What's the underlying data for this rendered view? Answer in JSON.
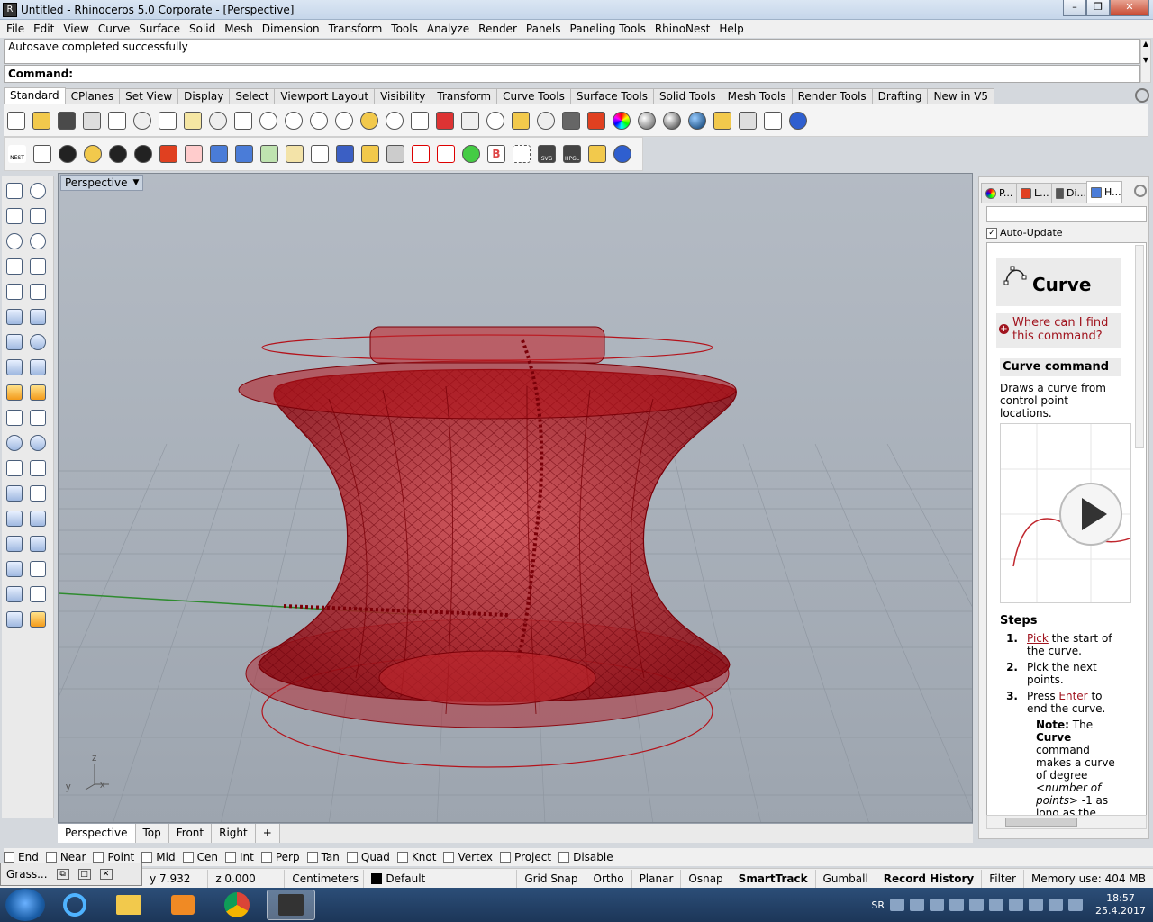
{
  "window": {
    "title": "Untitled - Rhinoceros  5.0 Corporate - [Perspective]",
    "min_label": "–",
    "max_label": "❐",
    "close_label": "✕"
  },
  "menu": [
    "File",
    "Edit",
    "View",
    "Curve",
    "Surface",
    "Solid",
    "Mesh",
    "Dimension",
    "Transform",
    "Tools",
    "Analyze",
    "Render",
    "Panels",
    "Paneling Tools",
    "RhinoNest",
    "Help"
  ],
  "command": {
    "history": "Autosave completed successfully",
    "prompt": "Command:"
  },
  "toolbar_tabs": [
    "Standard",
    "CPlanes",
    "Set View",
    "Display",
    "Select",
    "Viewport Layout",
    "Visibility",
    "Transform",
    "Curve Tools",
    "Surface Tools",
    "Solid Tools",
    "Mesh Tools",
    "Render Tools",
    "Drafting",
    "New in V5"
  ],
  "toolbar2_labels": {
    "nest": "NEST",
    "svg": "SVG",
    "hpgl": "HPGL",
    "bold_b": "B"
  },
  "viewport": {
    "label": "Perspective",
    "axis_z": "z",
    "axis_y": "y",
    "axis_x": "x"
  },
  "view_tabs": [
    "Perspective",
    "Top",
    "Front",
    "Right",
    "+"
  ],
  "right_panel": {
    "tabs": [
      "P...",
      "L...",
      "Di...",
      "H..."
    ],
    "auto_update": "Auto-Update",
    "help_title": "Curve",
    "where_link": "Where can I find this command?",
    "command_heading": "Curve command",
    "description": "Draws a curve from control point locations.",
    "steps_heading": "Steps",
    "steps": [
      {
        "n": "1.",
        "link": "Pick",
        "rest": " the start of the curve."
      },
      {
        "n": "2.",
        "link": "",
        "rest": "Pick the next points."
      },
      {
        "n": "3.",
        "link": "Enter",
        "pre": "Press ",
        "rest": " to end the curve."
      }
    ],
    "note_label": "Note:",
    "note_text1": " The ",
    "note_bold": "Curve",
    "note_text2": " command makes a curve of degree ",
    "note_italic": "<number of points>",
    "note_text3": " -1 as long as the"
  },
  "osnaps": [
    "End",
    "Near",
    "Point",
    "Mid",
    "Cen",
    "Int",
    "Perp",
    "Tan",
    "Quad",
    "Knot",
    "Vertex",
    "Project",
    "Disable"
  ],
  "status": {
    "grasshopper": "Grass...",
    "y": "y 7.932",
    "z": "z 0.000",
    "units": "Centimeters",
    "layer": "Default",
    "grid_snap": "Grid Snap",
    "ortho": "Ortho",
    "planar": "Planar",
    "osnap": "Osnap",
    "smarttrack": "SmartTrack",
    "gumball": "Gumball",
    "record_history": "Record History",
    "filter": "Filter",
    "memory": "Memory use: 404 MB"
  },
  "taskbar": {
    "lang": "SR",
    "time": "18:57",
    "date": "25.4.2017"
  },
  "colors": {
    "accent_red": "#a0141e",
    "viewport_bg": "#a9b1bb",
    "model_red": "#b4121a"
  }
}
